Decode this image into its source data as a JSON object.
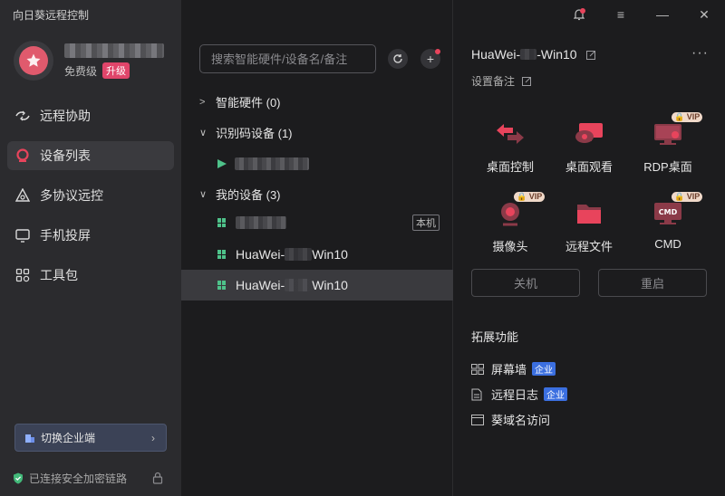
{
  "app": {
    "title": "向日葵远程控制"
  },
  "user": {
    "tier": "免费级",
    "upgrade_label": "升级"
  },
  "nav": [
    {
      "label": "远程协助",
      "icon": "remote-assist-icon"
    },
    {
      "label": "设备列表",
      "icon": "device-list-icon"
    },
    {
      "label": "多协议远控",
      "icon": "multi-protocol-icon"
    },
    {
      "label": "手机投屏",
      "icon": "screen-cast-icon"
    },
    {
      "label": "工具包",
      "icon": "toolkit-icon"
    }
  ],
  "sidebar_footer": {
    "switch_label": "切换企业端",
    "secure_text": "已连接安全加密链路"
  },
  "search": {
    "placeholder": "搜索智能硬件/设备名/备注"
  },
  "groups": {
    "smart_hw": "智能硬件 (0)",
    "id_code": "识别码设备 (1)",
    "my_devices": "我的设备 (3)"
  },
  "devices": {
    "local_tag": "本机",
    "dev2_prefix": "HuaWei-",
    "dev2_suffix": "Win10",
    "dev3_prefix": "HuaWei-",
    "dev3_suffix": "Win10"
  },
  "detail": {
    "name_prefix": "HuaWei-",
    "name_suffix": "-Win10",
    "remark": "设置备注",
    "features": {
      "desktop_control": "桌面控制",
      "desktop_view": "桌面观看",
      "rdp": "RDP桌面",
      "camera": "摄像头",
      "remote_file": "远程文件",
      "cmd": "CMD",
      "vip": "VIP",
      "cmd_screen": "CMD"
    },
    "shutdown": "关机",
    "restart": "重启",
    "ext_title": "拓展功能",
    "ext": {
      "screen_wall": "屏幕墙",
      "remote_log": "远程日志",
      "domain_access": "葵域名访问",
      "enterprise": "企业"
    }
  },
  "colors": {
    "accent": "#e0456a",
    "win": "#4ec28a",
    "enterprise": "#3b6fe0"
  }
}
